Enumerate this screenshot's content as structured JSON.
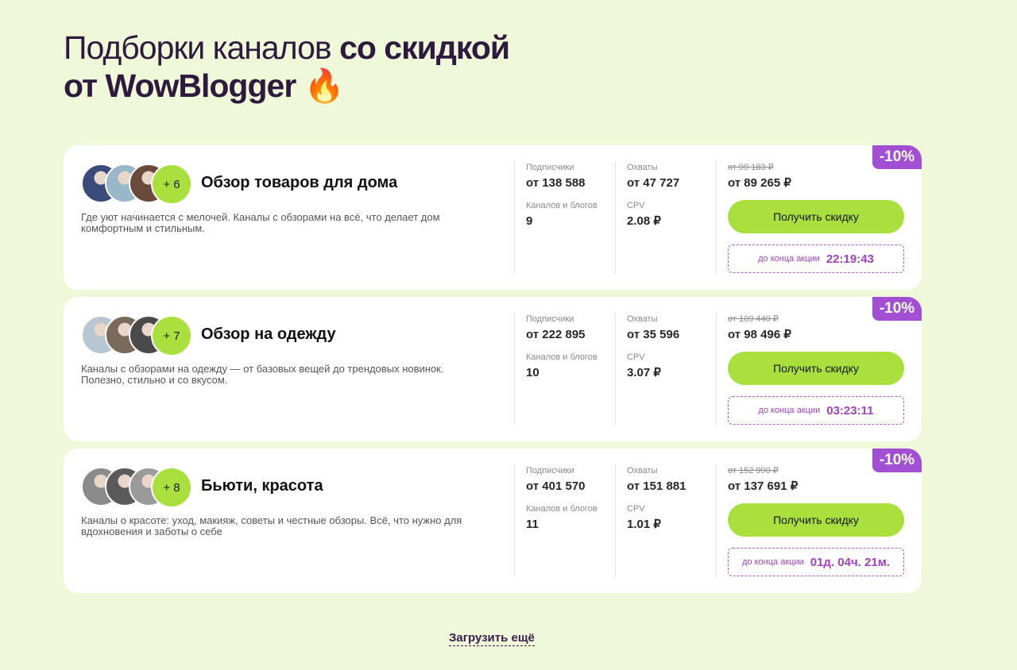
{
  "header": {
    "title_line1_light": "Подборки каналов ",
    "title_line1_bold": "со скидкой",
    "title_line2": "от WowBlogger ",
    "title_emoji": "🔥"
  },
  "labels": {
    "subscribers": "Подписчики",
    "reach": "Охваты",
    "channels": "Каналов и блогов",
    "cpv": "CPV",
    "button": "Получить скидку",
    "timer": "до конца акции"
  },
  "cards": [
    {
      "title": "Обзор товаров для дома",
      "plus": "+ 6",
      "description": "Где уют начинается с мелочей. Каналы с обзорами на всё, что делает дом комфортным и стильным.",
      "subscribers": "от 138 588",
      "reach": "от 47 727",
      "channels": "9",
      "cpv": "2.08 ₽",
      "old_price": "от 99 183 ₽",
      "new_price": "от 89 265 ₽",
      "timer": "22:19:43",
      "discount": "-10%",
      "avatar_colors": [
        "#3a4a7a",
        "#9ab6c9",
        "#6a4a3a"
      ]
    },
    {
      "title": "Обзор на одежду",
      "plus": "+ 7",
      "description": "Каналы с обзорами на одежду — от базовых вещей до трендовых новинок. Полезно, стильно и со вкусом.",
      "subscribers": "от 222 895",
      "reach": "от 35 596",
      "channels": "10",
      "cpv": "3.07 ₽",
      "old_price": "от 109 440 ₽",
      "new_price": "от 98 496 ₽",
      "timer": "03:23:11",
      "discount": "-10%",
      "avatar_colors": [
        "#b8c6d2",
        "#7a6a5a",
        "#4a4a4a"
      ]
    },
    {
      "title": "Бьюти, красота",
      "plus": "+ 8",
      "description": "Каналы о красоте: уход, макияж, советы и честные обзоры. Всё, что нужно для вдохновения и заботы о себе",
      "subscribers": "от 401 570",
      "reach": "от 151 881",
      "channels": "11",
      "cpv": "1.01 ₽",
      "old_price": "от 152 990 ₽",
      "new_price": "от 137 691 ₽",
      "timer": "01д. 04ч. 21м.",
      "discount": "-10%",
      "avatar_colors": [
        "#8a8a8a",
        "#5a5a5a",
        "#9a9a9a"
      ]
    }
  ],
  "load_more": "Загрузить ещё"
}
